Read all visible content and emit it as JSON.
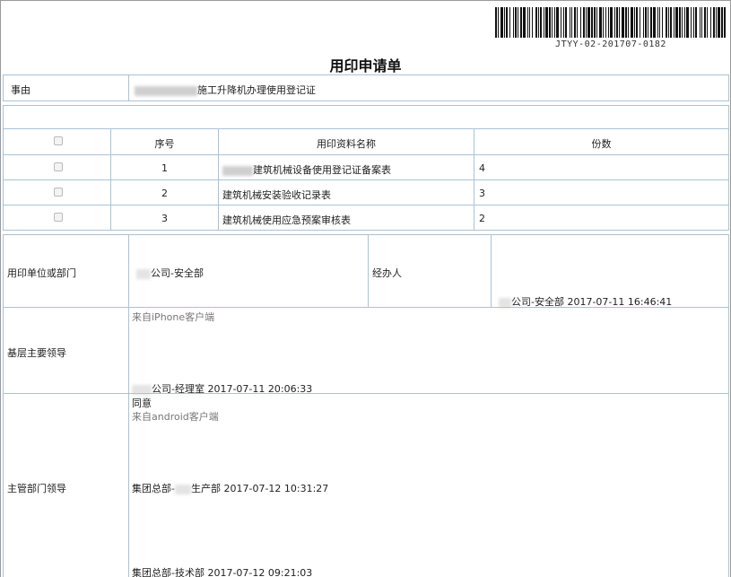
{
  "barcode": {
    "text": "JTYY-02-201707-0182"
  },
  "title": "用印申请单",
  "reason": {
    "label": "事由",
    "value": "施工升降机办理使用登记证"
  },
  "table": {
    "headers": {
      "seq": "序号",
      "name": "用印资料名称",
      "count": "份数"
    },
    "rows": [
      {
        "seq": "1",
        "name": "建筑机械设备使用登记证备案表",
        "count": "4"
      },
      {
        "seq": "2",
        "name": "建筑机械安装验收记录表",
        "count": "3"
      },
      {
        "seq": "3",
        "name": "建筑机械使用应急预案审核表",
        "count": "2"
      }
    ]
  },
  "dept": {
    "label": "用印单位或部门",
    "value": "公司-安全部",
    "handler_label": "经办人",
    "handler_value": "公司-安全部 2017-07-11 16:46:41"
  },
  "grassroots": {
    "label": "基层主要领导",
    "source": "来自iPhone客户端",
    "sign": "公司-经理室 2017-07-11 20:06:33"
  },
  "supervisor": {
    "label": "主管部门领导",
    "opinion": "同意",
    "source": "来自android客户端",
    "sign1_prefix": "集团总部-",
    "sign1_suffix": "生产部 2017-07-12 10:31:27",
    "sign2": "集团总部-技术部 2017-07-12 09:21:03"
  }
}
